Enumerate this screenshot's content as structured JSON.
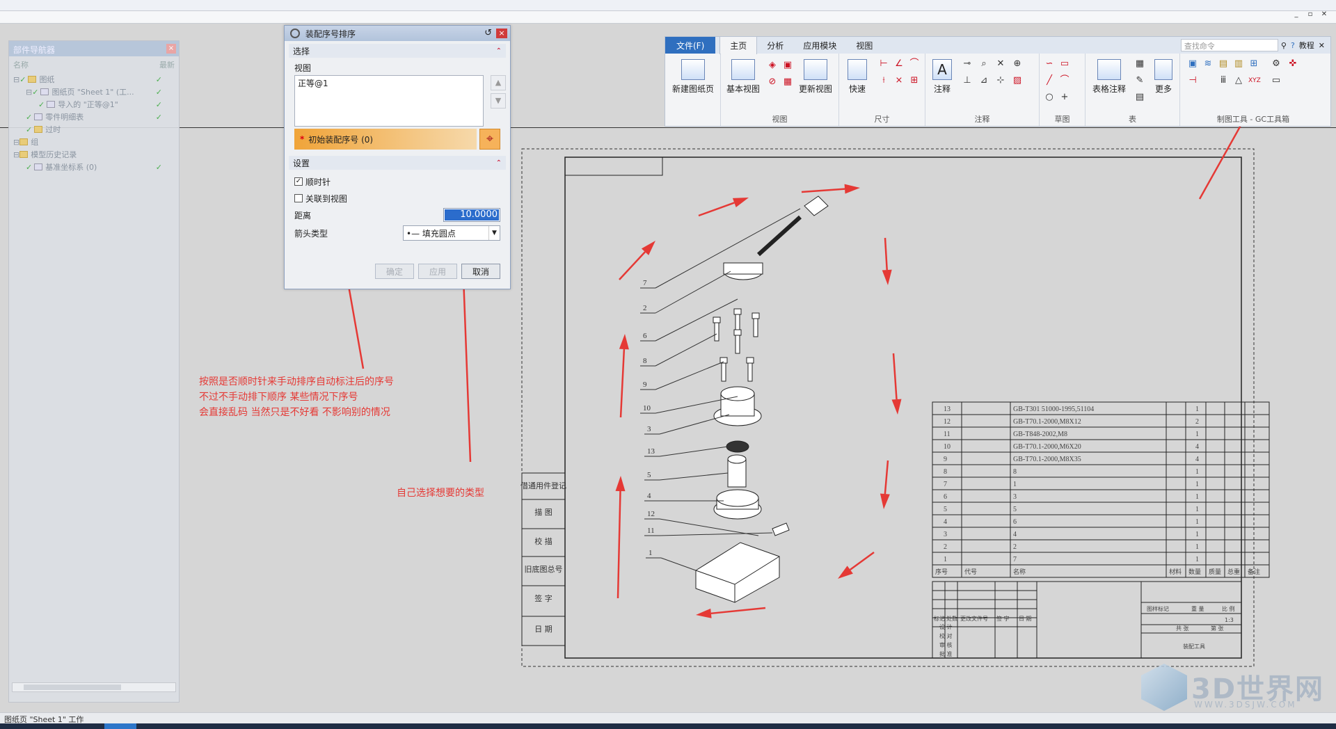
{
  "window": {
    "min": "_",
    "restore": "▫",
    "close": "✕"
  },
  "navigator": {
    "title": "部件导航器",
    "close": "×",
    "col_name": "名称",
    "col_latest": "最新",
    "items": [
      {
        "label": "图纸",
        "indent": 0
      },
      {
        "label": "图纸页 \"Sheet 1\" (工...",
        "indent": 1
      },
      {
        "label": "导入的 \"正等@1\"",
        "indent": 2
      },
      {
        "label": "零件明细表",
        "indent": 1
      },
      {
        "label": "过时",
        "indent": 1
      },
      {
        "label": "组",
        "indent": 0
      },
      {
        "label": "模型历史记录",
        "indent": 0
      },
      {
        "label": "基准坐标系 (0)",
        "indent": 1
      }
    ]
  },
  "dialog": {
    "title": "装配序号排序",
    "reset": "↺",
    "close": "×",
    "section_select": "选择",
    "view_label": "视图",
    "view_list": [
      "正等@1"
    ],
    "arrow_up": "▲",
    "arrow_down": "▼",
    "initial_balloon": "初始装配序号 (0)",
    "star": "*",
    "section_settings": "设置",
    "clockwise": "顺时针",
    "assoc_view": "关联到视图",
    "distance_label": "距离",
    "distance_value": "10.0000",
    "arrow_type_label": "箭头类型",
    "arrow_type_value": "•— 填充圆点",
    "ok": "确定",
    "apply": "应用",
    "cancel": "取消"
  },
  "ribbon": {
    "tabs": [
      "文件(F)",
      "主页",
      "分析",
      "应用模块",
      "视图"
    ],
    "search_placeholder": "查找命令",
    "tutorial": "教程",
    "buttons": {
      "new_sheet": "新建图纸页",
      "base_view": "基本视图",
      "update_view": "更新视图",
      "quick": "快速",
      "note": "注释",
      "table_note": "表格注释",
      "more": "更多"
    },
    "groups": [
      "视图",
      "尺寸",
      "注释",
      "草图",
      "表",
      "制图工具 - GC工具箱"
    ]
  },
  "drawing": {
    "balloons": [
      "7",
      "2",
      "6",
      "8",
      "9",
      "10",
      "3",
      "13",
      "5",
      "4",
      "12",
      "11",
      "1"
    ],
    "left_strip": [
      "借通用件登记",
      "描  图",
      "校  描",
      "旧底图总号",
      "签  字",
      "日  期"
    ],
    "bom": [
      {
        "no": "13",
        "code": "GB-T301 51000-1995,51104",
        "qty": "1"
      },
      {
        "no": "12",
        "code": "GB-T70.1-2000,M8X12",
        "qty": "2"
      },
      {
        "no": "11",
        "code": "GB-T848-2002,M8",
        "qty": "1"
      },
      {
        "no": "10",
        "code": "GB-T70.1-2000,M6X20",
        "qty": "4"
      },
      {
        "no": "9",
        "code": "GB-T70.1-2000,M8X35",
        "qty": "4"
      },
      {
        "no": "8",
        "code": "8",
        "qty": "1"
      },
      {
        "no": "7",
        "code": "1",
        "qty": "1"
      },
      {
        "no": "6",
        "code": "3",
        "qty": "1"
      },
      {
        "no": "5",
        "code": "5",
        "qty": "1"
      },
      {
        "no": "4",
        "code": "6",
        "qty": "1"
      },
      {
        "no": "3",
        "code": "4",
        "qty": "1"
      },
      {
        "no": "2",
        "code": "2",
        "qty": "1"
      },
      {
        "no": "1",
        "code": "7",
        "qty": "1"
      }
    ],
    "bom_header": [
      "序号",
      "代号",
      "名称",
      "材料",
      "数量",
      "质量",
      "总重",
      "备注"
    ],
    "title_cells": [
      "标记",
      "处数",
      "更改文件号",
      "签 字",
      "日 期",
      "设 计",
      "校 对",
      "审 核",
      "批 准",
      "图样标记",
      "重 量",
      "比 例",
      "1:3",
      "共 张",
      "第 张",
      "装配工具"
    ]
  },
  "annotations": {
    "note1": [
      "按照是否顺时针来手动排序自动标注后的序号",
      "不过不手动排下顺序 某些情况下序号",
      "会直接乱码  当然只是不好看 不影响别的情况"
    ],
    "note2": "自己选择想要的类型"
  },
  "status_bar": "图纸页 \"Sheet 1\" 工作",
  "watermark": {
    "title": "3D世界网",
    "url": "WWW.3DSJW.COM"
  },
  "colors": {
    "arrow": "#e53935",
    "accent": "#2f6fbf",
    "balloon_bar": "#f0a439"
  }
}
